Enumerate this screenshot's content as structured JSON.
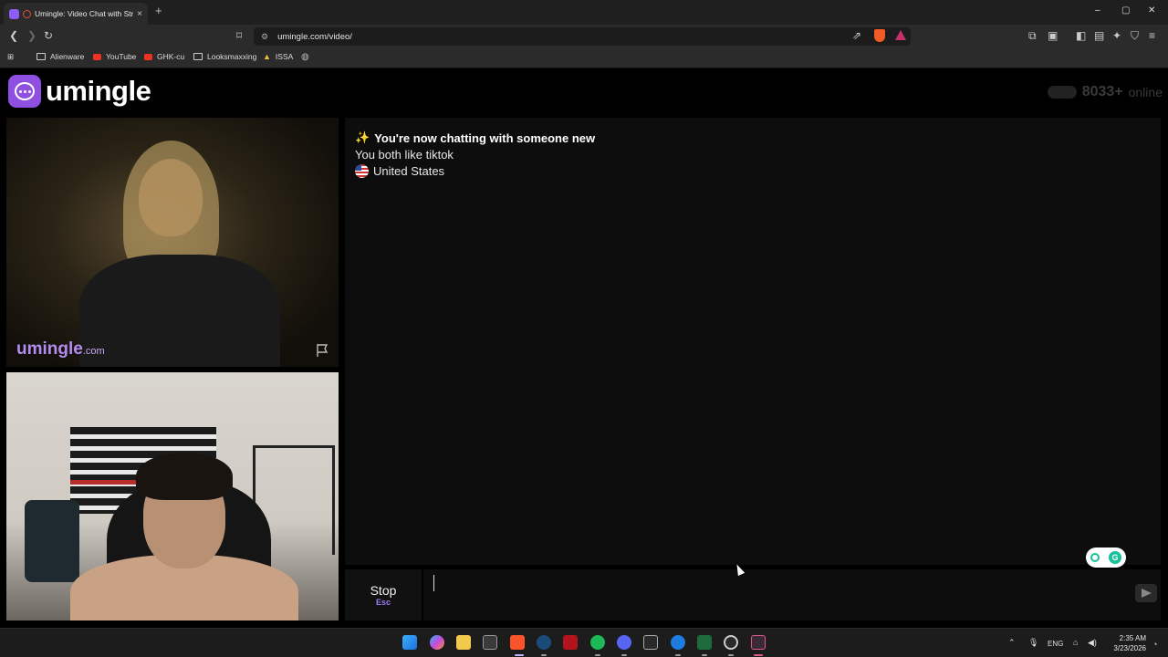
{
  "browser": {
    "tab_title": "Umingle: Video Chat with Str",
    "tab_close": "×",
    "new_tab": "+",
    "url": "umingle.com/video/",
    "window_controls": {
      "minimize": "–",
      "maximize": "▢",
      "close": "✕"
    }
  },
  "bookmarks": [
    {
      "label": "Alienware",
      "icon": "folder-icon"
    },
    {
      "label": "YouTube",
      "icon": "youtube-icon"
    },
    {
      "label": "GHK-cu",
      "icon": "youtube-icon"
    },
    {
      "label": "Looksmaxxing",
      "icon": "folder-icon"
    },
    {
      "label": "ISSA",
      "icon": "issa-icon"
    },
    {
      "label": "",
      "icon": "globe-icon"
    }
  ],
  "site": {
    "logo_text": "umingle",
    "online_count": "8033+",
    "online_label": "online",
    "brand_color": "#8f4fe0"
  },
  "remote_video": {
    "watermark": "umingle",
    "watermark_suffix": ".com"
  },
  "chat": {
    "lines": [
      {
        "icon": "sparkles-icon",
        "text": "You're now chatting with someone new"
      },
      {
        "text": "You both like tiktok"
      },
      {
        "icon": "us-flag-icon",
        "text": "United States"
      }
    ],
    "sparkle": "✨"
  },
  "controls": {
    "stop_label": "Stop",
    "stop_key": "Esc",
    "message_value": "",
    "message_placeholder": ""
  },
  "taskbar": {
    "icons": [
      "windows-start-icon",
      "copilot-icon",
      "file-explorer-icon",
      "store-icon",
      "brave-icon",
      "steam-icon",
      "app-red-icon",
      "spotify-icon",
      "discord-icon",
      "epic-games-icon",
      "edge-icon",
      "excel-icon",
      "obs-icon",
      "epic-games-launcher-icon"
    ],
    "tray_lang": "ENG",
    "time": "2:35 AM",
    "date": "3/23/2026"
  }
}
